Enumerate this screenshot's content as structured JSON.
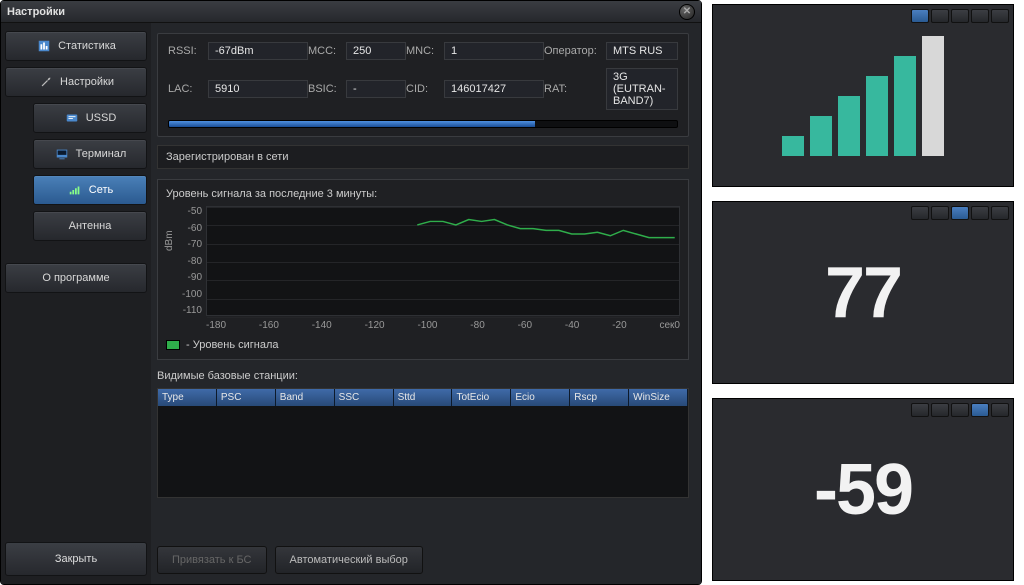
{
  "window": {
    "title": "Настройки",
    "close_button": "Закрыть"
  },
  "sidebar": {
    "items": [
      {
        "id": "statistics",
        "label": "Статистика",
        "icon": "stats-icon"
      },
      {
        "id": "settings",
        "label": "Настройки",
        "icon": "wrench-icon"
      },
      {
        "id": "ussd",
        "label": "USSD",
        "icon": "ussd-icon"
      },
      {
        "id": "terminal",
        "label": "Терминал",
        "icon": "terminal-icon"
      },
      {
        "id": "network",
        "label": "Сеть",
        "icon": "network-icon",
        "active": true
      },
      {
        "id": "antenna",
        "label": "Антенна",
        "icon": ""
      }
    ],
    "about": "О программе"
  },
  "info": {
    "rssi_label": "RSSI:",
    "rssi": "-67dBm",
    "mcc_label": "MCC:",
    "mcc": "250",
    "mnc_label": "MNC:",
    "mnc": "1",
    "operator_label": "Оператор:",
    "operator": "MTS RUS",
    "lac_label": "LAC:",
    "lac": "5910",
    "bsic_label": "BSIC:",
    "bsic": "-",
    "cid_label": "CID:",
    "cid": "146017427",
    "rat_label": "RAT:",
    "rat": "3G (EUTRAN-BAND7)",
    "progress_percent": 72
  },
  "status": "Зарегистрирован в сети",
  "chart_section": {
    "title": "Уровень сигнала за последние 3 минуты:",
    "ylabel": "dBm",
    "legend": "- Уровень сигнала",
    "xunit": "сек"
  },
  "chart_data": {
    "type": "line",
    "title": "Уровень сигнала за последние 3 минуты",
    "xlabel": "сек",
    "ylabel": "dBm",
    "ylim": [
      -110,
      -50
    ],
    "xlim": [
      -180,
      0
    ],
    "yticks": [
      -50,
      -60,
      -70,
      -80,
      -90,
      -100,
      -110
    ],
    "xticks": [
      -180,
      -160,
      -140,
      -120,
      -100,
      -80,
      -60,
      -40,
      -20,
      0
    ],
    "series": [
      {
        "name": "Уровень сигнала",
        "color": "#2fae4b",
        "x": [
          -100,
          -95,
          -90,
          -85,
          -80,
          -75,
          -70,
          -65,
          -60,
          -55,
          -50,
          -45,
          -40,
          -35,
          -30,
          -25,
          -20,
          -15,
          -10,
          -5,
          0
        ],
        "values": [
          -60,
          -58,
          -58,
          -60,
          -57,
          -58,
          -57,
          -60,
          -62,
          -62,
          -63,
          -63,
          -65,
          -65,
          -64,
          -66,
          -63,
          -65,
          -67,
          -67,
          -67
        ]
      }
    ]
  },
  "stations": {
    "title": "Видимые базовые станции:",
    "columns": [
      "Type",
      "PSC",
      "Band",
      "SSC",
      "Sttd",
      "TotEcio",
      "Ecio",
      "Rscp",
      "WinSize"
    ]
  },
  "bottom": {
    "bind_button": "Привязать к БС",
    "auto_button": "Автоматический выбор"
  },
  "side_panels": {
    "signal_bars": {
      "levels": [
        20,
        40,
        60,
        80,
        100,
        120
      ],
      "active_count": 5
    },
    "value_a": "77",
    "value_b": "-59"
  }
}
